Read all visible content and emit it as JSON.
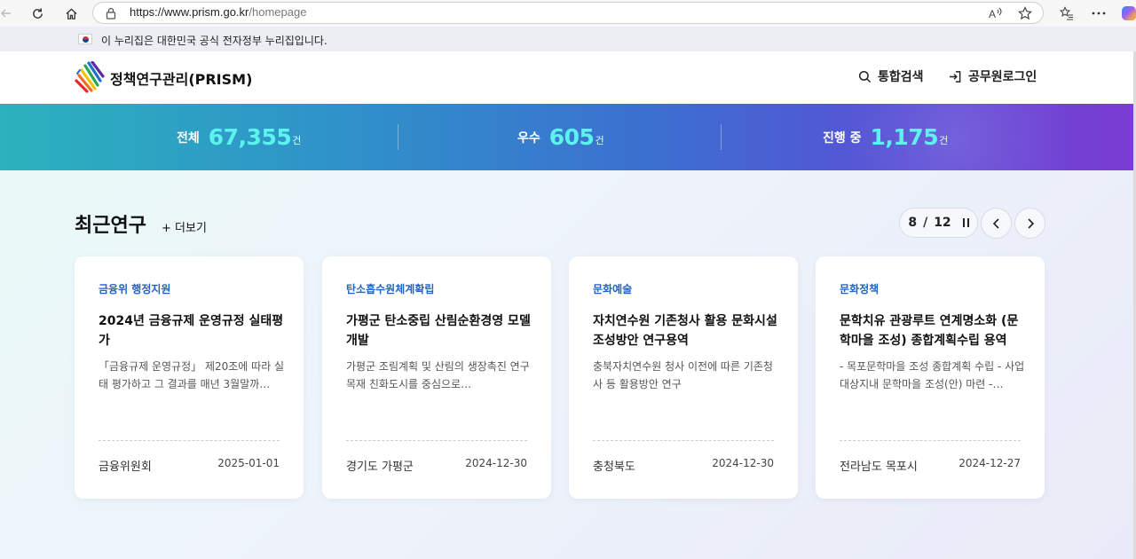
{
  "browser": {
    "url_domain": "https://www.prism.go.kr",
    "url_path": "/homepage"
  },
  "gov_banner": {
    "text": "이 누리집은 대한민국 공식 전자정부 누리집입니다."
  },
  "header": {
    "logo_text": "정책연구관리(PRISM)",
    "search_label": "통합검색",
    "login_label": "공무원로그인"
  },
  "stats": [
    {
      "label": "전체",
      "value": "67,355",
      "unit": "건"
    },
    {
      "label": "우수",
      "value": "605",
      "unit": "건"
    },
    {
      "label": "진행 중",
      "value": "1,175",
      "unit": "건"
    }
  ],
  "recent": {
    "title": "최근연구",
    "more_label": "+ 더보기",
    "pager_current": "8",
    "pager_sep": "/",
    "pager_total": "12"
  },
  "cards": [
    {
      "category": "금융위 행정지원",
      "title": "2024년 금융규제 운영규정 실태평가",
      "desc": "「금융규제 운영규정」 제20조에 따라 실태 평가하고 그 결과를 매년 3월말까…",
      "org": "금융위원회",
      "date": "2025-01-01"
    },
    {
      "category": "탄소흡수원체계확립",
      "title": "가평군 탄소중립 산림순환경영 모델 개발",
      "desc": "가평군 조림계획 및 산림의 생장촉진 연구 목재 친화도시를 중심으로…",
      "org": "경기도 가평군",
      "date": "2024-12-30"
    },
    {
      "category": "문화예술",
      "title": "자치연수원 기존청사 활용 문화시설 조성방안 연구용역",
      "desc": "충북자치연수원 청사 이전에 따른 기존청사 등 활용방안 연구",
      "org": "충청북도",
      "date": "2024-12-30"
    },
    {
      "category": "문화정책",
      "title": "문학치유 관광루트 연계명소화 (문학마을 조성) 종합계획수립 용역",
      "desc": "- 목포문학마을 조성 종합계획 수립 - 사업대상지내 문학마을 조성(안) 마련 -…",
      "org": "전라남도 목포시",
      "date": "2024-12-27"
    }
  ],
  "colors": {
    "accent_number": "#5ef2ef",
    "category_blue": "#1f63c4"
  }
}
